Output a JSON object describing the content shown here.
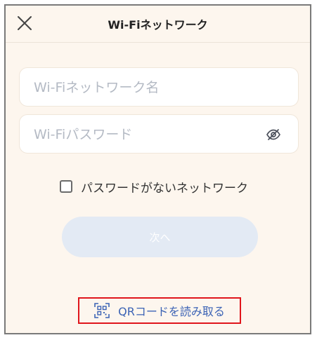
{
  "header": {
    "title": "Wi-Fiネットワーク"
  },
  "form": {
    "ssid_placeholder": "Wi-Fiネットワーク名",
    "ssid_value": "",
    "password_placeholder": "Wi-Fiパスワード",
    "password_value": "",
    "no_password_label": "パスワードがないネットワーク",
    "no_password_checked": false,
    "next_label": "次へ"
  },
  "qr": {
    "label": "QRコードを読み取る"
  },
  "icons": {
    "close": "close-icon",
    "eye": "eye-off-icon",
    "qr": "qr-scan-icon"
  },
  "colors": {
    "background": "#fdf6ee",
    "accent_link": "#3c63b5",
    "disabled_button": "#e3eaf4",
    "highlight_border": "#e0151b"
  }
}
